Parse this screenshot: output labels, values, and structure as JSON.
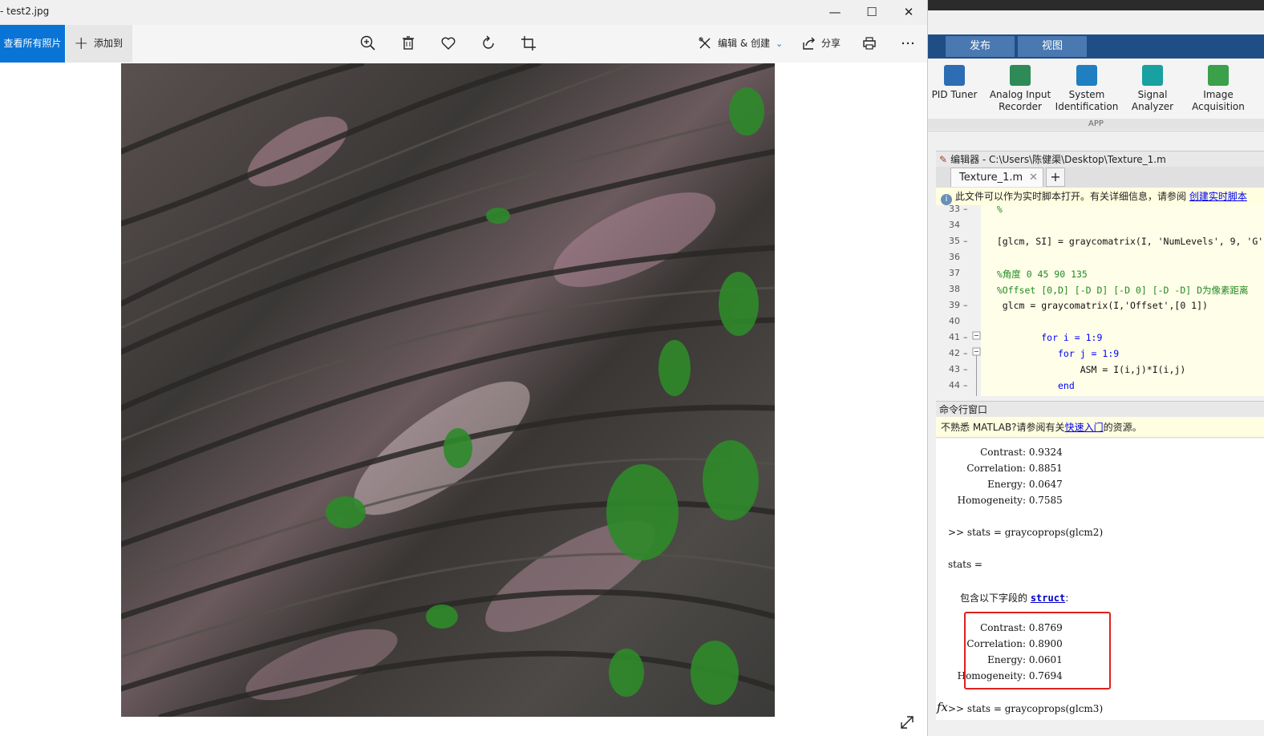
{
  "photos": {
    "window_title": "- test2.jpg",
    "view_all_label": "查看所有照片",
    "add_to_label": "添加到",
    "edit_create_label": "编辑 & 创建",
    "share_label": "分享"
  },
  "matlab": {
    "tabs": [
      "发布",
      "视图"
    ],
    "apps": [
      {
        "label": "PID Tuner",
        "icon": "pid-tuner-icon",
        "color": "#2d6db3"
      },
      {
        "label": "Analog Input Recorder",
        "icon": "analog-input-recorder-icon",
        "color": "#2e8b57"
      },
      {
        "label": "System Identification",
        "icon": "system-identification-icon",
        "color": "#1f7fc0"
      },
      {
        "label": "Signal Analyzer",
        "icon": "signal-analyzer-icon",
        "color": "#19a0a0"
      },
      {
        "label": "Image Acquisition",
        "icon": "image-acquisition-icon",
        "color": "#3aa04a"
      }
    ],
    "app_section_label": "APP",
    "editor": {
      "title": "编辑器 - C:\\Users\\陈健渠\\Desktop\\Texture_1.m",
      "tab_name": "Texture_1.m",
      "info_text": "此文件可以作为实时脚本打开。有关详细信息，请参阅 ",
      "info_link": "创建实时脚本",
      "lines": [
        {
          "n": "33",
          "dash": "–",
          "code": "  %"
        },
        {
          "n": "34",
          "dash": "",
          "code": ""
        },
        {
          "n": "35",
          "dash": "–",
          "code": "  [glcm, SI] = graycomatrix(I, 'NumLevels', 9, 'G',"
        },
        {
          "n": "36",
          "dash": "",
          "code": ""
        },
        {
          "n": "37",
          "dash": "",
          "code": "  %角度 0 45 90 135"
        },
        {
          "n": "38",
          "dash": "",
          "code": "  %Offset [0,D] [-D D] [-D 0] [-D -D] D为像素距离"
        },
        {
          "n": "39",
          "dash": "–",
          "code": "   glcm = graycomatrix(I,'Offset',[0 1])"
        },
        {
          "n": "40",
          "dash": "",
          "code": ""
        },
        {
          "n": "41",
          "dash": "–",
          "code": "          for i = 1:9"
        },
        {
          "n": "42",
          "dash": "–",
          "code": "             for j = 1:9"
        },
        {
          "n": "43",
          "dash": "–",
          "code": "                 ASM = I(i,j)*I(i,j)"
        },
        {
          "n": "44",
          "dash": "–",
          "code": "             end"
        }
      ]
    },
    "command": {
      "title": "命令行窗口",
      "info_prefix": "不熟悉 MATLAB?请参阅有关",
      "info_link": "快速入门",
      "info_suffix": "的资源。",
      "stats1": [
        {
          "k": "Contrast:",
          "v": "0.9324"
        },
        {
          "k": "Correlation:",
          "v": "0.8851"
        },
        {
          "k": "Energy:",
          "v": "0.0647"
        },
        {
          "k": "Homogeneity:",
          "v": "0.7585"
        }
      ],
      "prompt2": ">> stats = graycoprops(glcm2)",
      "stats_eq": "stats =",
      "struct_prefix": "包含以下字段的 ",
      "struct_link": "struct",
      "struct_suffix": ":",
      "stats2": [
        {
          "k": "Contrast:",
          "v": "0.8769"
        },
        {
          "k": "Correlation:",
          "v": "0.8900"
        },
        {
          "k": "Energy:",
          "v": "0.0601"
        },
        {
          "k": "Homogeneity:",
          "v": "0.7694"
        }
      ],
      "prompt3": ">> stats = graycoprops(glcm3)",
      "fx_label": "fx"
    }
  }
}
